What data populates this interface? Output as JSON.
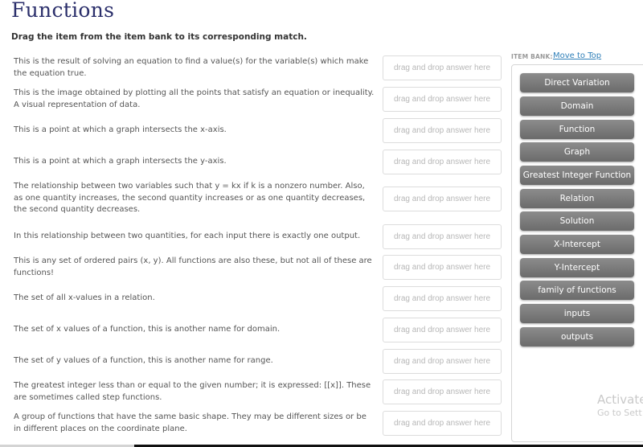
{
  "page": {
    "title": "Functions",
    "instructions": "Drag the item from the item bank to its corresponding match."
  },
  "drop_placeholder": "drag and drop answer here",
  "prompts": [
    "This is the result of solving an equation to find a value(s) for the variable(s) which make the equation true.",
    "This is the image obtained by plotting all the points that satisfy an equation or inequality. A visual representation of data.",
    "This is a point at which a graph intersects the x-axis.",
    "This is a point at which a graph intersects the y-axis.",
    "The relationship between two variables such that y = kx if k is a nonzero number. Also, as one quantity increases, the second quantity increases or as one quantity decreases, the second quantity decreases.",
    "In this relationship between two quantities, for each input there is exactly one output.",
    "This is any set of ordered pairs (x, y). All functions are also these, but not all of these are functions!",
    "The set of all x-values in a relation.",
    "The set of x values of a function, this is another name for domain.",
    "The set of y values of a function, this is another name for range.",
    "The greatest integer less than or equal to the given number; it is expressed: [[x]]. These are sometimes called step functions.",
    "A group of functions that have the same basic shape. They may be different sizes or be in different places on the coordinate plane."
  ],
  "item_bank": {
    "label": "ITEM BANK:",
    "move_to_top": "Move to Top",
    "items": [
      "Direct Variation",
      "Domain",
      "Function",
      "Graph",
      "Greatest Integer Function",
      "Relation",
      "Solution",
      "X-Intercept",
      "Y-Intercept",
      "family of functions",
      "inputs",
      "outputs"
    ]
  },
  "watermark": {
    "line1": "Activate",
    "line2": "Go to Sett"
  }
}
